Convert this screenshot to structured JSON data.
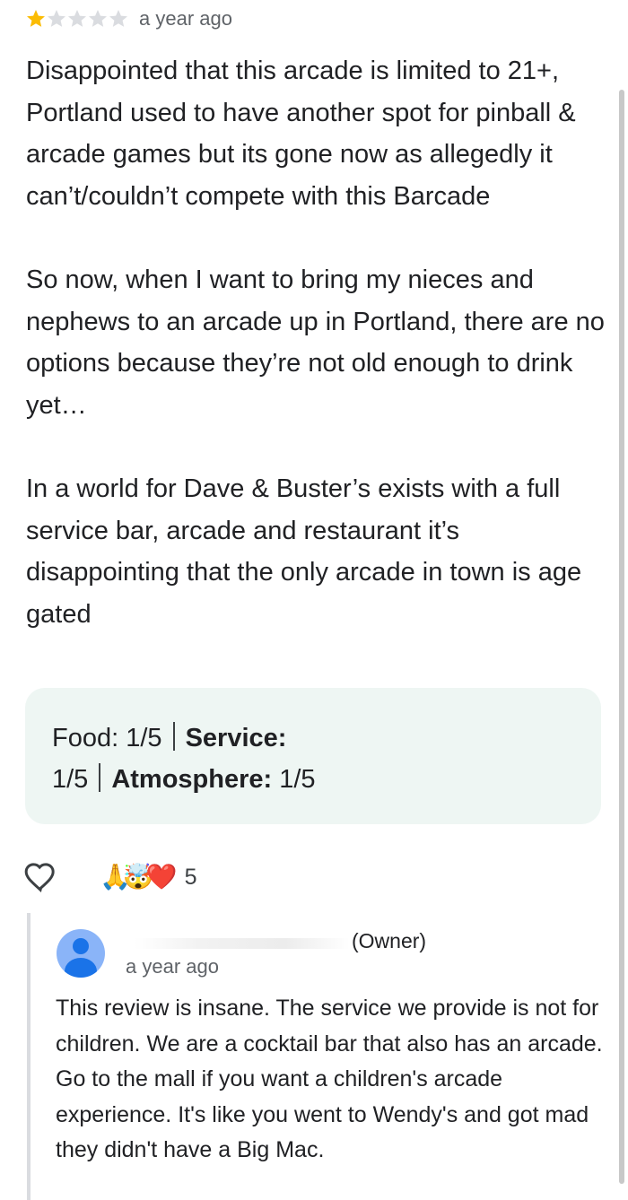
{
  "review": {
    "rating": 1,
    "max_rating": 5,
    "time_ago": "a year ago",
    "paragraphs": [
      "Disappointed that this arcade is limited to 21+, Portland used to have another spot for pinball & arcade games but its gone now as allegedly it can’t/couldn’t compete with this Barcade",
      "So now, when I want to bring my nieces and nephews to an arcade up in Portland, there are no options because they’re not old enough to drink yet…",
      "In a world for Dave & Buster’s exists with a full service bar, arcade and restaurant it’s disappointing that the only arcade in town is age gated"
    ],
    "subratings": {
      "food_label": "Food:",
      "food_value": "1/5",
      "service_label": "Service:",
      "service_value": "1/5",
      "atmosphere_label": "Atmosphere:",
      "atmosphere_value": "1/5"
    },
    "reactions": {
      "emojis": [
        "🙏",
        "🤯",
        "❤️"
      ],
      "count": "5"
    }
  },
  "owner_response": {
    "label": "(Owner)",
    "time_ago": "a year ago",
    "text": "This review is insane. The service we provide is not for children. We are a cocktail bar that also has an arcade. Go to the mall if you want a children's arcade experience. It's like you went to Wendy's and got mad they didn't have a Big Mac."
  },
  "colors": {
    "star_filled": "#fbbc04",
    "star_empty": "#dadce0",
    "subratings_bg": "#eef6f3",
    "avatar_bg": "#8ab4f8"
  }
}
